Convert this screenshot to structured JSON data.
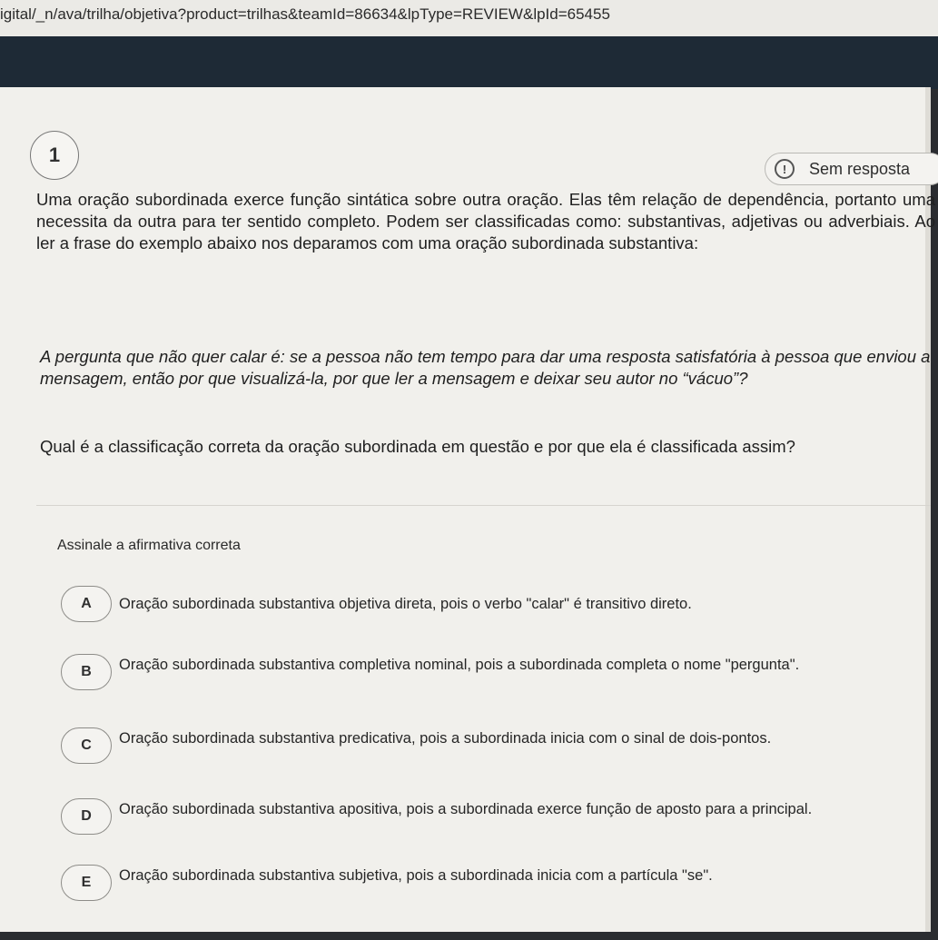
{
  "browser": {
    "url": "igital/_n/ava/trilha/objetiva?product=trilhas&teamId=86634&lpType=REVIEW&lpId=65455"
  },
  "question": {
    "number": "1",
    "status": "Sem resposta",
    "prompt": "Uma oração subordinada exerce função sintática sobre outra oração. Elas têm relação de dependência, portanto uma necessita da outra para ter sentido completo. Podem ser classificadas como: substantivas, adjetivas ou adverbiais. Ao ler a frase do exemplo abaixo nos deparamos com uma oração subordinada substantiva:",
    "example": "A pergunta que não quer calar é: se a pessoa não tem tempo para dar uma resposta satisfatória à pessoa que enviou a mensagem, então por que visualizá-la, por que ler a mensagem e deixar seu autor no “vácuo”?",
    "text": "Qual é a classificação correta da oração subordinada em questão e por que ela é classificada assim?",
    "instruction": "Assinale a afirmativa correta"
  },
  "options": [
    {
      "letter": "A",
      "text": "Oração subordinada substantiva objetiva direta, pois o verbo \"calar\" é transitivo direto."
    },
    {
      "letter": "B",
      "text": "Oração subordinada substantiva completiva nominal, pois a subordinada completa o nome \"pergunta\"."
    },
    {
      "letter": "C",
      "text": "Oração subordinada substantiva predicativa, pois a subordinada inicia com o sinal de dois-pontos."
    },
    {
      "letter": "D",
      "text": "Oração subordinada substantiva apositiva, pois a subordinada exerce função de aposto para a principal."
    },
    {
      "letter": "E",
      "text": "Oração subordinada substantiva subjetiva, pois a subordinada inicia com a partícula \"se\"."
    }
  ],
  "icons": {
    "status": "alert-circle-icon"
  },
  "colors": {
    "page_background": "#f1f0ec",
    "header_band": "#1e2a36"
  }
}
